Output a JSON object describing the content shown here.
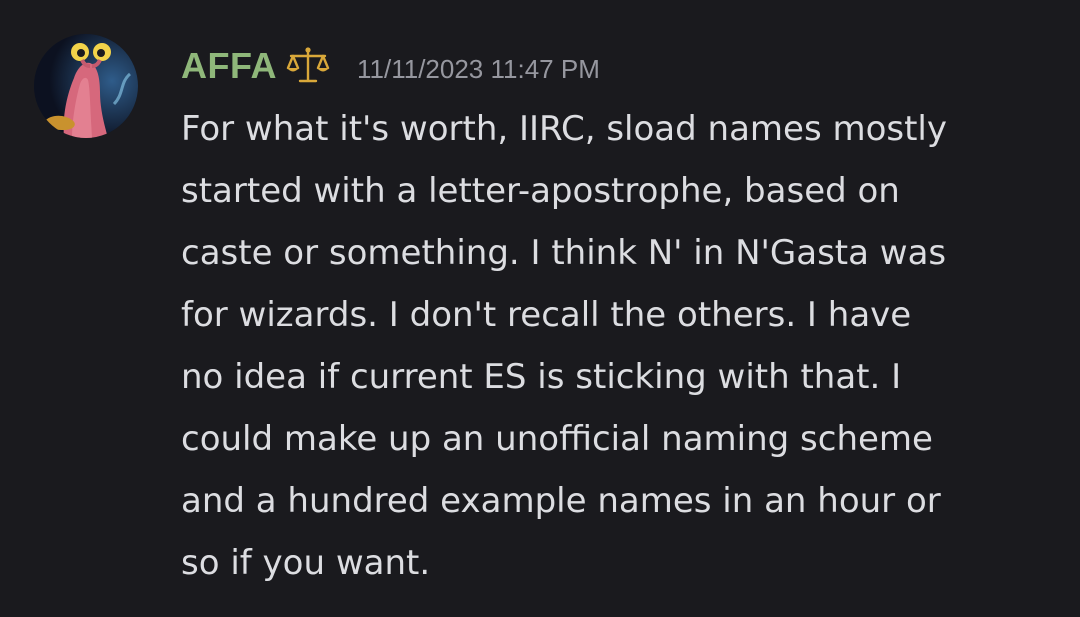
{
  "message": {
    "author": "AFFA",
    "timestamp": "11/11/2023 11:47 PM",
    "role_icon": "scales-of-justice-icon",
    "avatar": "avatar-pink-creature-with-lamp",
    "lines": [
      "For what it's worth, IIRC, sload names mostly",
      "started with a letter-apostrophe, based on",
      "caste or something. I think N' in N'Gasta was",
      "for wizards. I don't recall the others. I have",
      "no idea if current ES is sticking with that. I",
      "could make up an unofficial naming scheme",
      "and a hundred example names in an hour or",
      "so if you want."
    ]
  },
  "colors": {
    "background": "#1a1a1e",
    "username": "#8fb77a",
    "timestamp": "#96979f",
    "text": "#dcdde1",
    "role_icon": "#d9a83a"
  }
}
